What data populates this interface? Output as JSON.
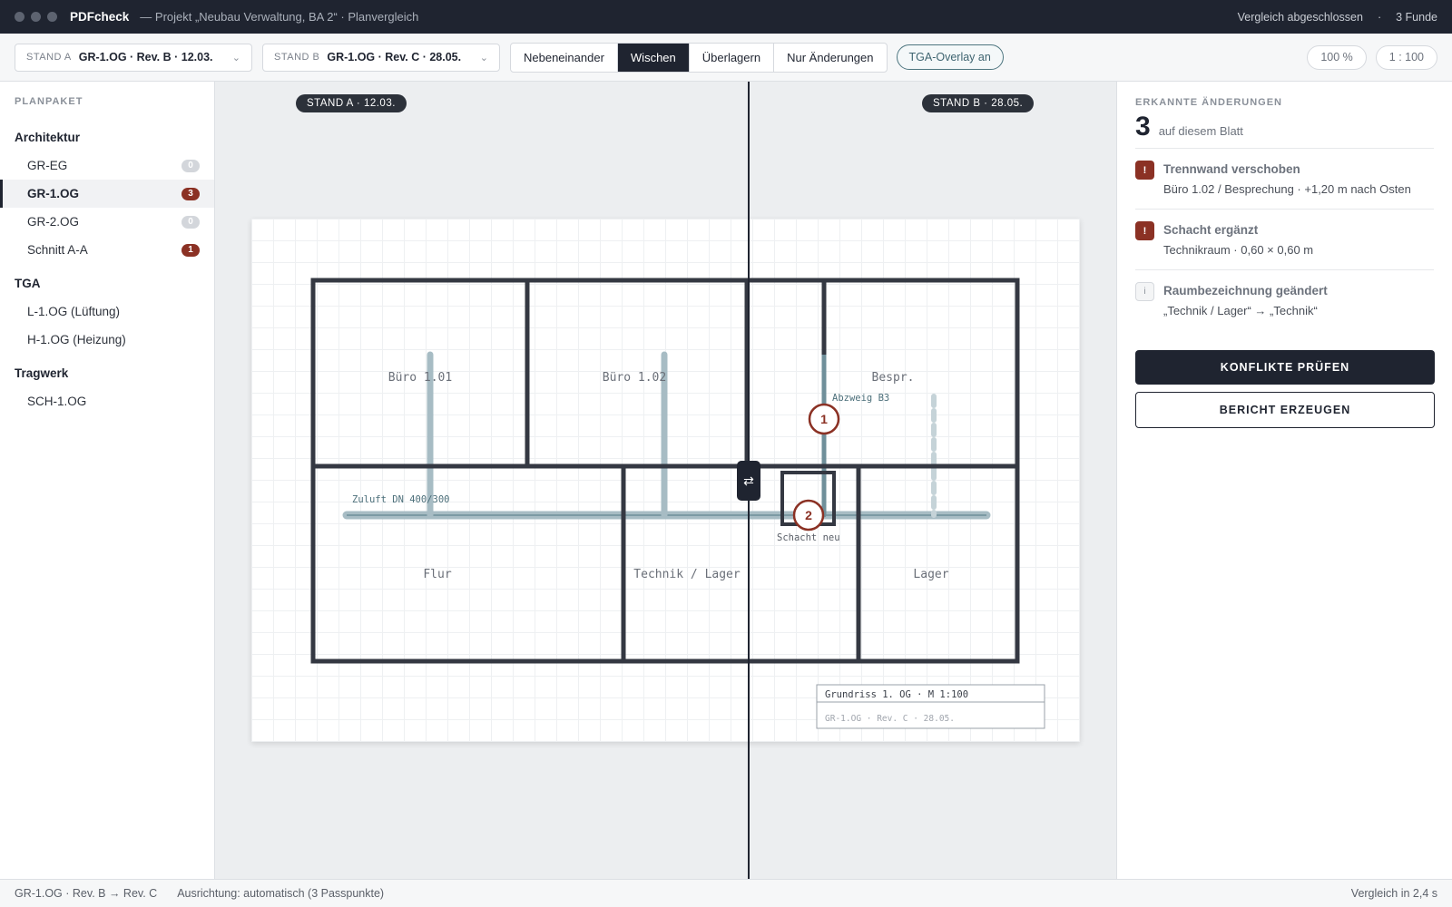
{
  "window": {
    "app_name": "PDFcheck",
    "doc_title": "— Projekt „Neubau Verwaltung, BA 2“ · Planvergleich",
    "status": "Vergleich abgeschlossen",
    "separator": "·",
    "findings": "3 Funde"
  },
  "toolbar": {
    "stand_a": {
      "label": "STAND A",
      "value": "GR-1.OG · Rev. B · 12.03."
    },
    "stand_b": {
      "label": "STAND B",
      "value": "GR-1.OG · Rev. C · 28.05."
    },
    "modes": [
      "Nebeneinander",
      "Wischen",
      "Überlagern",
      "Nur Änderungen"
    ],
    "active_mode": "Wischen",
    "overlay_toggle": "TGA-Overlay an",
    "zoom": "100 %",
    "scale": "1 : 100"
  },
  "sidebar": {
    "heading": "PLANPAKET",
    "groups": [
      {
        "name": "Architektur",
        "items": [
          {
            "label": "GR-EG",
            "count": "0"
          },
          {
            "label": "GR-1.OG",
            "count": "3"
          },
          {
            "label": "GR-2.OG",
            "count": "0"
          },
          {
            "label": "Schnitt A-A",
            "count": "1"
          }
        ]
      },
      {
        "name": "TGA",
        "items": [
          {
            "label": "L-1.OG (Lüftung)"
          },
          {
            "label": "H-1.OG (Heizung)"
          }
        ]
      },
      {
        "name": "Tragwerk",
        "items": [
          {
            "label": "SCH-1.OG"
          }
        ]
      }
    ]
  },
  "canvas": {
    "tag_a": "STAND A · 12.03.",
    "tag_b": "STAND B · 28.05.",
    "rooms": [
      "Büro 1.01",
      "Büro 1.02",
      "Bespr.",
      "Flur",
      "Technik / Lager",
      "Lager"
    ],
    "annotations": {
      "duct": "Zuluft DN 400/300",
      "branch": "Abzweig B3",
      "shaft": "Schacht neu"
    },
    "markers": [
      "1",
      "2"
    ],
    "handle_icon": "⇄",
    "title_block": {
      "line1": "Grundriss 1. OG · M 1:100",
      "line2": "GR-1.OG · Rev. C · 28.05."
    }
  },
  "changes": {
    "heading": "ERKANNTE ÄNDERUNGEN",
    "count": "3",
    "count_text": "auf diesem Blatt",
    "items": [
      {
        "icon": "!",
        "title": "Trennwand verschoben",
        "detail": "Büro 1.02 / Besprechung · +1,20 m nach Osten"
      },
      {
        "icon": "!",
        "title": "Schacht ergänzt",
        "detail": "Technikraum · 0,60 × 0,60 m"
      },
      {
        "icon": "i",
        "title": "Raumbezeichnung geändert",
        "detail": "„Technik / Lager“ → „Technik“"
      }
    ],
    "btn_conflicts": "KONFLIKTE PRÜFEN",
    "btn_report": "BERICHT ERZEUGEN"
  },
  "statusbar": {
    "revision": "GR-1.OG · Rev. B → Rev. C",
    "alignment": "Ausrichtung: automatisch (3 Passpunkte)",
    "duration": "Vergleich in 2,4 s"
  },
  "colors": {
    "dark": "#1f2430",
    "alert": "#8b3124",
    "duct": "#9fb7c0",
    "teal": "#3e6470"
  }
}
